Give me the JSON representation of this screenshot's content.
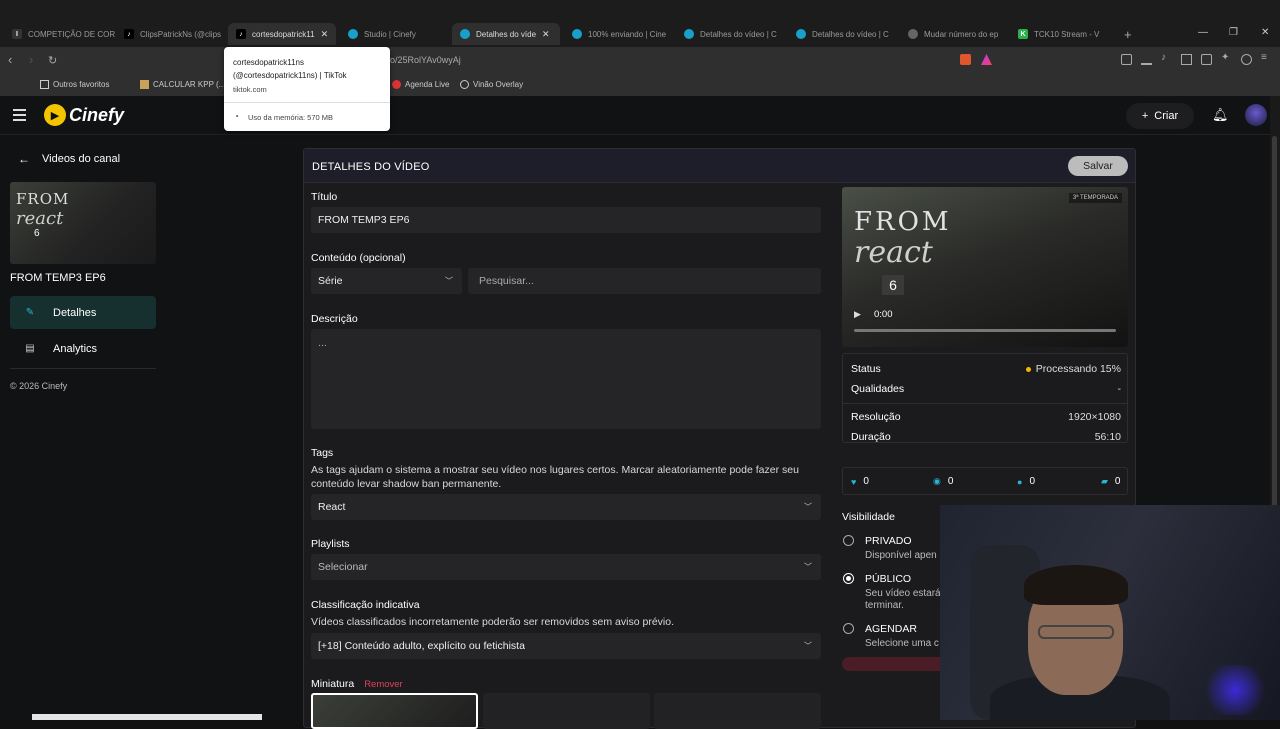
{
  "browser": {
    "tabs": [
      {
        "label": "COMPETIÇÃO DE COR",
        "icon": "t-icon",
        "color": "#2d2d2d"
      },
      {
        "label": "ClipsPatrickNs (@clips",
        "icon": "tiktok-icon",
        "color": "#000000"
      },
      {
        "label": "cortesdopatrick11",
        "icon": "tiktok-icon",
        "color": "#000000",
        "active": true
      },
      {
        "label": "Studio | Cinefy",
        "icon": "cinefy-icon",
        "color": "#19a0c9"
      },
      {
        "label": "Detalhes do víde",
        "icon": "cinefy-icon",
        "color": "#19a0c9",
        "active2": true
      },
      {
        "label": "100% enviando | Cine",
        "icon": "cinefy-icon",
        "color": "#19a0c9"
      },
      {
        "label": "Detalhes do vídeo | C",
        "icon": "cinefy-icon",
        "color": "#19a0c9"
      },
      {
        "label": "Detalhes do vídeo | C",
        "icon": "cinefy-icon",
        "color": "#19a0c9"
      },
      {
        "label": "Mudar número do ep",
        "icon": "globe-icon",
        "color": "#888888"
      },
      {
        "label": "TCK10 Stream - V",
        "icon": "k-icon",
        "color": "#2bb34a"
      }
    ],
    "url": "o/25RolYAv0wyAj",
    "bookmarks": [
      "Outros favoritos",
      "CALCULAR KPP (...",
      "Agenda Live",
      "Vinão Overlay"
    ],
    "tooltip": {
      "title_line1": "cortesdopatrick11ns",
      "title_line2": "(@cortesdopatrick11ns) | TikTok",
      "host": "tiktok.com",
      "memory": "Uso da memória: 570 MB"
    }
  },
  "app": {
    "logo": "Cinefy",
    "create_label": "Criar",
    "sidebar": {
      "back_label": "Videos do canal",
      "video_title": "FROM TEMP3 EP6",
      "thumb_line1": "FROM",
      "thumb_line2": "react",
      "thumb_line3": "6",
      "items": [
        {
          "label": "Detalhes",
          "icon": "edit-icon"
        },
        {
          "label": "Analytics",
          "icon": "chart-icon"
        }
      ],
      "copyright": "© 2026 Cinefy"
    },
    "card": {
      "title": "DETALHES DO VÍDEO",
      "save_label": "Salvar",
      "title_label": "Título",
      "title_value": "FROM TEMP3 EP6",
      "content_label": "Conteúdo (opcional)",
      "content_type": "Série",
      "search_placeholder": "Pesquisar...",
      "description_label": "Descrição",
      "description_value": "...",
      "tags_label": "Tags",
      "tags_help": "As tags ajudam o sistema a mostrar seu vídeo nos lugares certos. Marcar aleatoriamente pode fazer seu conteúdo levar shadow ban permanente.",
      "tags_value": "React",
      "playlists_label": "Playlists",
      "playlists_value": "Selecionar",
      "rating_label": "Classificação indicativa",
      "rating_help": "Vídeos classificados incorretamente poderão ser removidos sem aviso prévio.",
      "rating_value": "[+18] Conteúdo adulto, explícito ou fetichista",
      "thumbnail_label": "Miniatura",
      "thumbnail_remove": "Remover"
    },
    "player": {
      "line1": "FROM",
      "line2": "react",
      "episode": "6",
      "season_badge": "3ª TEMPORADA",
      "time": "0:00"
    },
    "info": {
      "status_label": "Status",
      "status_value": "Processando 15%",
      "status_color": "#f5b400",
      "qualities_label": "Qualidades",
      "qualities_value": "-",
      "resolution_label": "Resolução",
      "resolution_value": "1920×1080",
      "duration_label": "Duração",
      "duration_value": "56:10"
    },
    "stats": [
      {
        "icon": "heart-icon",
        "value": "0",
        "color": "#29b6d6"
      },
      {
        "icon": "eye-icon",
        "value": "0",
        "color": "#29b6d6"
      },
      {
        "icon": "dot-icon",
        "value": "0",
        "color": "#29b6d6"
      },
      {
        "icon": "comment-icon",
        "value": "0",
        "color": "#29b6d6"
      }
    ],
    "visibility": {
      "title": "Visibilidade",
      "options": [
        {
          "label": "PRIVADO",
          "desc": "Disponível apen",
          "selected": false
        },
        {
          "label": "PÚBLICO",
          "desc": "Seu vídeo estará",
          "desc2": "terminar.",
          "selected": true
        },
        {
          "label": "AGENDAR",
          "desc": "Selecione uma c",
          "selected": false
        }
      ]
    }
  }
}
